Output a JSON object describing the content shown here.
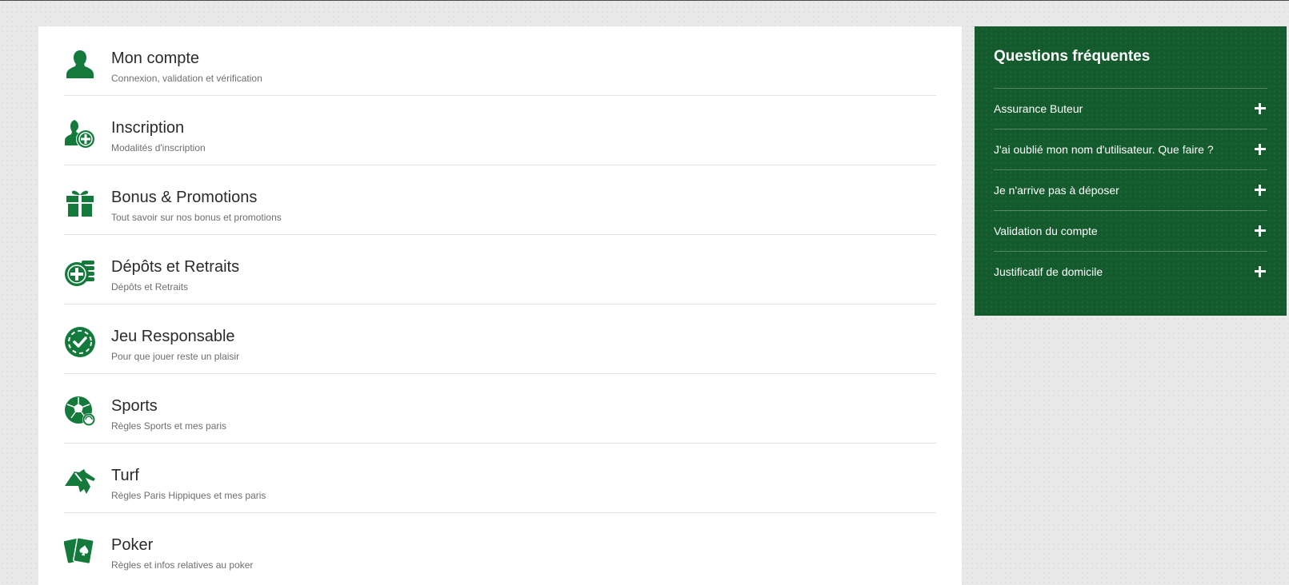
{
  "brand_color": "#137a3c",
  "faq_panel_color": "#135a2d",
  "categories": [
    {
      "title": "Mon compte",
      "subtitle": "Connexion, validation et vérification",
      "icon": "user-icon"
    },
    {
      "title": "Inscription",
      "subtitle": "Modalités d'inscription",
      "icon": "user-add-icon"
    },
    {
      "title": "Bonus & Promotions",
      "subtitle": "Tout savoir sur nos bonus et promotions",
      "icon": "gift-icon"
    },
    {
      "title": "Dépôts et Retraits",
      "subtitle": "Dépôts et Retraits",
      "icon": "coins-icon"
    },
    {
      "title": "Jeu Responsable",
      "subtitle": "Pour que jouer reste un plaisir",
      "icon": "chip-check-icon"
    },
    {
      "title": "Sports",
      "subtitle": "Règles Sports et mes paris",
      "icon": "soccer-ball-icon"
    },
    {
      "title": "Turf",
      "subtitle": "Règles Paris Hippiques et mes paris",
      "icon": "horse-icon"
    },
    {
      "title": "Poker",
      "subtitle": "Règles et infos relatives au poker",
      "icon": "cards-icon"
    }
  ],
  "faq": {
    "title": "Questions fréquentes",
    "items": [
      {
        "label": "Assurance Buteur",
        "icon": "plus-icon"
      },
      {
        "label": "J'ai oublié mon nom d'utilisateur. Que faire ?",
        "icon": "plus-icon"
      },
      {
        "label": "Je n'arrive pas à déposer",
        "icon": "plus-icon"
      },
      {
        "label": "Validation du compte",
        "icon": "plus-icon"
      },
      {
        "label": "Justificatif de domicile",
        "icon": "plus-icon"
      }
    ]
  }
}
